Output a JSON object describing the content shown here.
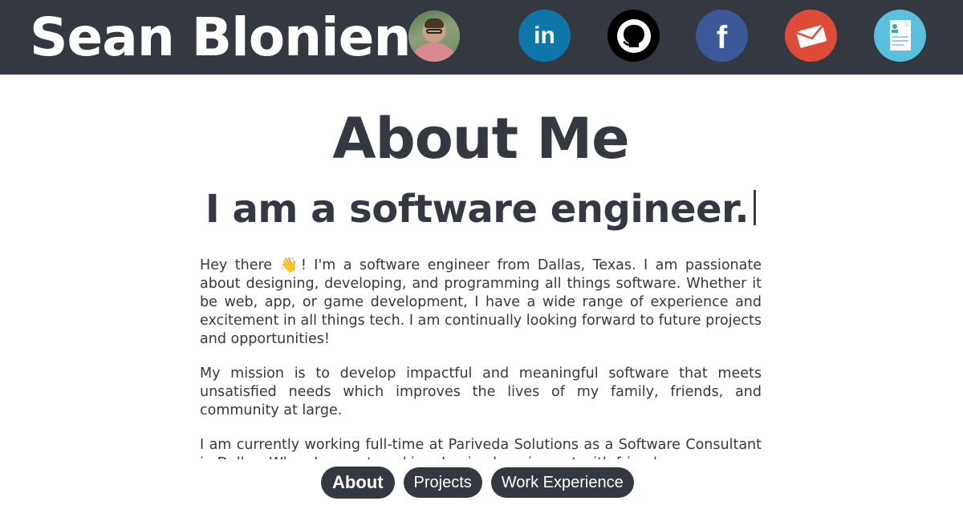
{
  "header": {
    "site_name": "Sean Blonien",
    "avatar_icon": "profile-photo",
    "social_links": [
      {
        "name": "linkedin",
        "icon": "linkedin-icon",
        "glyph": "in",
        "color": "#0e76a8"
      },
      {
        "name": "github",
        "icon": "github-icon",
        "color": "#000000"
      },
      {
        "name": "facebook",
        "icon": "facebook-icon",
        "glyph": "f",
        "color": "#3b5998"
      },
      {
        "name": "email",
        "icon": "envelope-icon",
        "color": "#dd4b39"
      },
      {
        "name": "resume",
        "icon": "resume-document-icon",
        "color": "#5bc0de"
      }
    ],
    "background_color": "#343840"
  },
  "main": {
    "title": "About Me",
    "tagline": "I am a software engineer.",
    "bio": {
      "p1_before_emoji": "Hey there ",
      "emoji": "👋",
      "p1_after_emoji": "! I'm a software engineer from Dallas, Texas. I am passionate about designing, developing, and programming all things software. Whether it be web, app, or game development, I have a wide range of experience and excitement in all things tech. I am continually looking forward to future projects and opportunities!",
      "p2": "My mission is to develop impactful and meaningful software that meets unsatisfied needs which improves the lives of my family, friends, and community at large.",
      "p3": "I am currently working full-time at Pariveda Solutions as a Software Consultant in Dallas. When I am not working, I enjoy hanging out with friends"
    }
  },
  "nav": {
    "items": [
      {
        "label": "About",
        "active": true
      },
      {
        "label": "Projects",
        "active": false
      },
      {
        "label": "Work Experience",
        "active": false
      }
    ]
  }
}
